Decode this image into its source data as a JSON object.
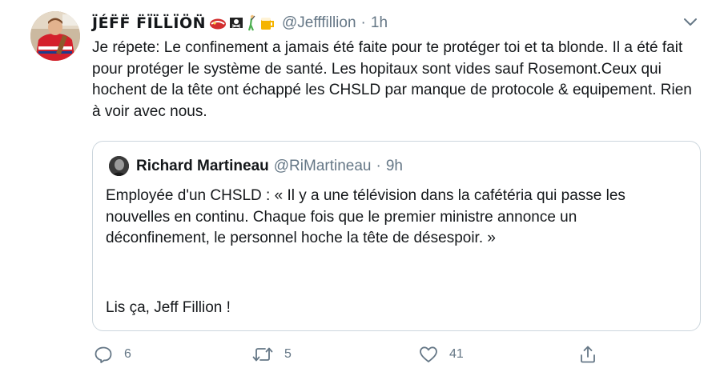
{
  "author": {
    "display_name": "J̈É̈F̈F̈ F̈ÏL̈L̈ÏÖN̈",
    "emojis": [
      "hockey-helmet-icon",
      "pirate-flag-icon",
      "golfer-icon",
      "beer-mug-icon"
    ],
    "handle": "@Jefffillion",
    "separator": "·",
    "time": "1h"
  },
  "tweet": {
    "text": "Je répete: Le confinement a jamais été faite pour te protéger toi et ta blonde. Il a été fait pour protéger le système de santé. Les hopitaux sont vides sauf Rosemont.Ceux qui hochent de la tête ont échappé les CHSLD par manque de protocole & equipement. Rien à voir avec nous."
  },
  "quoted": {
    "display_name": "Richard Martineau",
    "handle": "@RiMartineau",
    "separator": "·",
    "time": "9h",
    "text": "Employée d'un CHSLD : « Il y a une télévision dans la cafétéria qui passe les nouvelles en continu. Chaque fois que le premier ministre annonce un déconfinement, le personnel hoche la tête de désespoir. »",
    "text2": "Lis ça, Jeff Fillion !"
  },
  "actions": {
    "replies": "6",
    "retweets": "5",
    "likes": "41"
  },
  "colors": {
    "text": "#14171a",
    "secondary": "#657786",
    "border": "#ccd6dd"
  }
}
